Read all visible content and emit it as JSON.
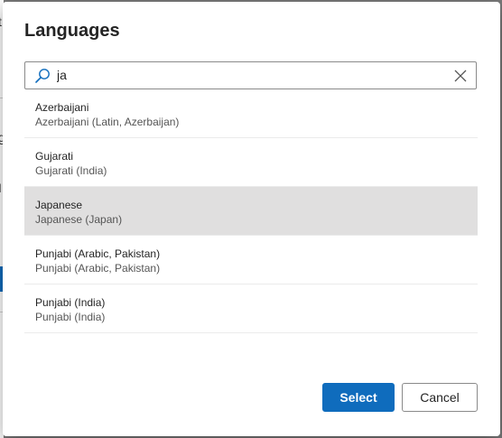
{
  "dialog": {
    "title": "Languages",
    "search": {
      "value": "ja",
      "search_icon": "search-icon",
      "clear_icon": "close-icon"
    },
    "items": [
      {
        "name": "Azerbaijani",
        "description": "Azerbaijani (Latin, Azerbaijan)",
        "selected": false
      },
      {
        "name": "Gujarati",
        "description": "Gujarati (India)",
        "selected": false
      },
      {
        "name": "Japanese",
        "description": "Japanese (Japan)",
        "selected": true
      },
      {
        "name": "Punjabi (Arabic, Pakistan)",
        "description": "Punjabi (Arabic, Pakistan)",
        "selected": false
      },
      {
        "name": "Punjabi (India)",
        "description": "Punjabi (India)",
        "selected": false
      }
    ],
    "select_label": "Select",
    "cancel_label": "Cancel"
  },
  "colors": {
    "accent": "#0f6cbd",
    "selected_row": "#e0dfdf",
    "overlay": "#7a7a7a"
  }
}
